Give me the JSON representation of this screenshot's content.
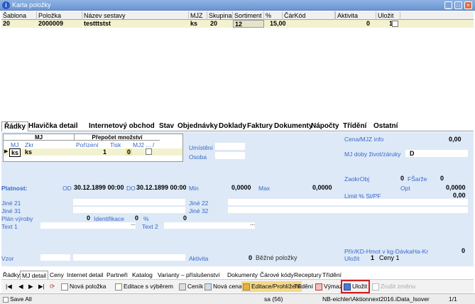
{
  "window": {
    "title": "Karta položky"
  },
  "grid": {
    "headers": [
      "Šablona",
      "Položka",
      "Název sestavy",
      "MJZ",
      "Skupina",
      "Sortiment",
      "% DPH",
      "ČárKód",
      "Aktivita",
      "Uložit"
    ],
    "row": {
      "sablona": "20",
      "polozka": "2000009",
      "nazev": "testttstst",
      "mjz": "ks",
      "skupina": "20",
      "sortiment": "12",
      "dph": "15,00",
      "carkod": "",
      "aktivita": "0",
      "ulozit": "1"
    }
  },
  "tabs_top": [
    "Řádky",
    "Hlavička detail",
    "Internetový obchod",
    "Stav",
    "Objednávky",
    "Doklady",
    "Faktury",
    "Dokumenty",
    "Nápočty",
    "Třídění",
    "Ostatní"
  ],
  "mj": {
    "group_mj": "MJ",
    "group_prepocet": "Přepočet množství",
    "headers": [
      "MJ",
      "Zkr",
      "Pořízení",
      "Tisk",
      "MJ2 ... /"
    ],
    "row": {
      "mj": "ks",
      "zkr": "ks",
      "porizeni": "1",
      "tisk": "0"
    }
  },
  "labels": {
    "umisteni": "Umístění",
    "osoba": "Osoba",
    "cena_mjz": "Cena/MJZ info",
    "cena_mjz_val": "0,00",
    "mj_doby": "MJ doby život/záruky",
    "mj_doby_val": "D",
    "zaokr": "ZaokrObj",
    "zaokr_val": "0",
    "fsarze": "FŠarže",
    "fsarze_val": "0",
    "platnost": "Platnost:",
    "od": "OD",
    "od_val": "30.12.1899 00:00",
    "do": "DO",
    "do_val": "30.12.1899 00:00",
    "min": "Min",
    "min_val": "0,0000",
    "max": "Max",
    "max_val": "0,0000",
    "opt": "Opt",
    "opt_val": "0,0000",
    "limit": "Limit % St/PF",
    "limit_val": "0,00",
    "jine21": "Jiné 21",
    "jine22": "Jiné 22",
    "jine31": "Jiné 31",
    "jine32": "Jiné 32",
    "plan": "Plán výroby",
    "plan_val": "0",
    "identifikace": "Identifikace",
    "ident_val": "0",
    "pct": "%",
    "pct_val": "0",
    "text1": "Text 1",
    "text2": "Text 2",
    "prir": "Přír/KD-Hmot v kg-DávkaHa-Kr",
    "prir_val": "0",
    "vzor": "Vzor",
    "aktivita": "Aktivita",
    "aktivita_val": "0",
    "bezne": "Běžné položky",
    "ulozit": "Uložit",
    "ulozit_val": "1",
    "ceny": "Ceny 1"
  },
  "tabs_bottom": [
    "Řádky",
    "MJ detail",
    "Ceny",
    "Internet detail",
    "Partneři",
    "Katalog",
    "Varianty – příslušenství",
    "Dokumenty",
    "Čárové kódy",
    "Receptury",
    "Třídění"
  ],
  "toolbar": {
    "nova_polozka": "Nová položka",
    "editace_vyber": "Editace s výběrem",
    "cenik": "Ceník",
    "nova_cena": "Nová cena",
    "editace_prohlizeni": "Editace/Prohlížení",
    "trideni": "Třídění",
    "vymaz": "Výmaz",
    "ulozit": "Uložit",
    "zrusit": "Zrušit změnu"
  },
  "status": {
    "save_all": "Save All",
    "count": "sa (56)",
    "path": "NB-eichler\\Aktionnext2016.iData_Isover",
    "page": "1/1"
  }
}
